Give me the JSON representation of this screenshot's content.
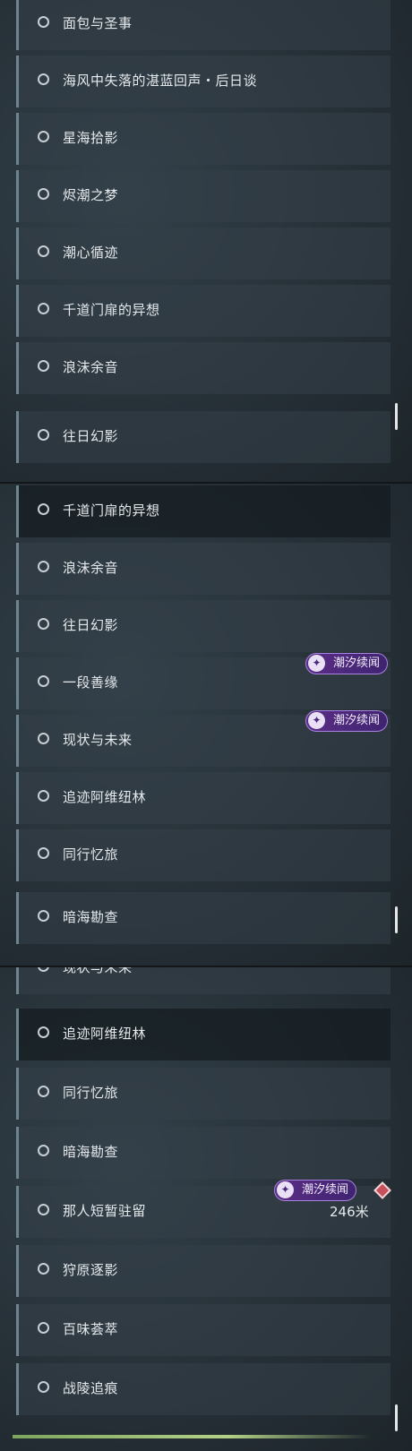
{
  "panels": [
    {
      "items": [
        "面包与圣事",
        "海风中失落的湛蓝回声・后日谈",
        "星海拾影",
        "烬潮之梦",
        "潮心循迹",
        "千道门扉的异想",
        "浪沫余音",
        "往日幻影"
      ]
    },
    {
      "items": [
        "千道门扉的异想",
        "浪沫余音",
        "往日幻影",
        "一段善缘",
        "现状与未来",
        "追迹阿维纽林",
        "同行忆旅",
        "暗海勘查"
      ],
      "badges": [
        "潮汐续闻",
        "潮汐续闻"
      ]
    },
    {
      "items": [
        "现状与未来",
        "追迹阿维纽林",
        "同行忆旅",
        "暗海勘查",
        "那人短暂驻留",
        "狩原逐影",
        "百味荟萃",
        "战陵追痕"
      ],
      "badges": [
        "潮汐续闻"
      ],
      "distance": "246米"
    }
  ],
  "badge_icon": "sparkle-swirl-icon",
  "colors": {
    "accent_bar": "#6c8591",
    "badge_purple": "#5a2d86",
    "marker_red": "#c8505b",
    "progress_green": "#b4d287"
  }
}
